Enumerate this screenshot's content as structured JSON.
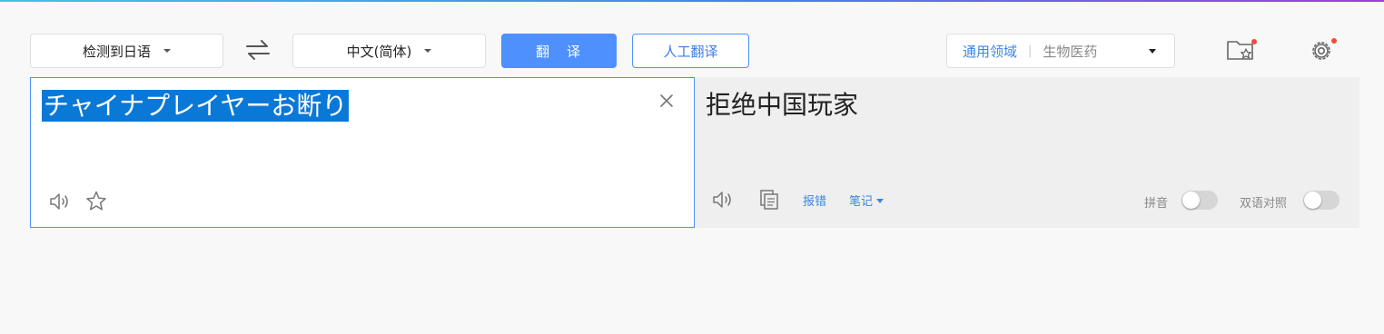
{
  "toolbar": {
    "source_lang": "检测到日语",
    "target_lang": "中文(简体)",
    "translate_label": "翻　译",
    "human_translate_label": "人工翻译",
    "domain_general": "通用领域",
    "domain_separator": "|",
    "domain_selected": "生物医药",
    "icons": [
      "swap-icon",
      "favorites-folder-icon",
      "settings-icon"
    ]
  },
  "source": {
    "text": "チャイナプレイヤーお断り",
    "icons": [
      "close-icon",
      "speaker-icon",
      "star-icon"
    ]
  },
  "target": {
    "text": "拒绝中国玩家",
    "report_label": "报错",
    "notes_label": "笔记",
    "pinyin_label": "拼音",
    "bilingual_label": "双语对照",
    "pinyin_on": false,
    "bilingual_on": false,
    "icons": [
      "speaker-icon",
      "copy-icon"
    ]
  },
  "colors": {
    "accent": "#4d90fe",
    "selection": "#0a78d7",
    "badge": "#f04a3e"
  }
}
